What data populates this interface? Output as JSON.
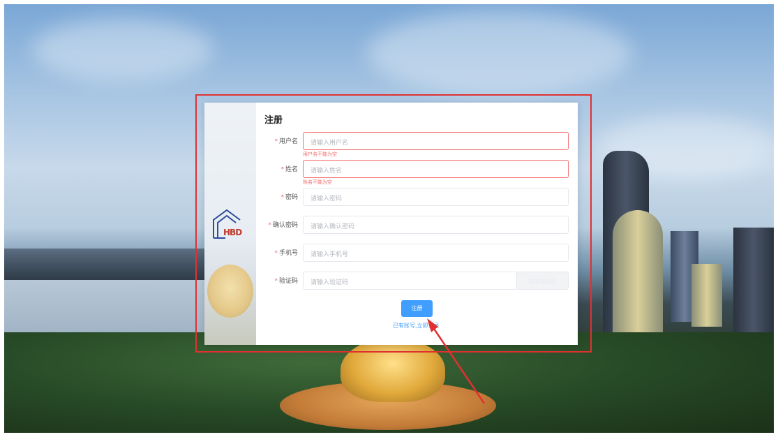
{
  "form": {
    "title": "注册",
    "fields": [
      {
        "label": "用户名",
        "required_mark": "*",
        "placeholder": "请输入用户名",
        "error": "用户名不能为空"
      },
      {
        "label": "姓名",
        "required_mark": "*",
        "placeholder": "请输入姓名",
        "error": "姓名不能为空"
      },
      {
        "label": "密码",
        "required_mark": "*",
        "placeholder": "请输入密码"
      },
      {
        "label": "确认密码",
        "required_mark": "*",
        "placeholder": "请输入确认密码"
      },
      {
        "label": "手机号",
        "required_mark": "*",
        "placeholder": "请输入手机号"
      },
      {
        "label": "验证码",
        "required_mark": "*",
        "placeholder": "请输入验证码"
      }
    ],
    "code_button": "获取验证码",
    "submit_label": "注册",
    "login_link": "已有账号,立即登录"
  },
  "brand": {
    "logo_text": "HBD",
    "logo_color": "#2f4b9a"
  },
  "colors": {
    "primary": "#409eff",
    "error": "#f56c6c",
    "annotation": "#e03131"
  },
  "icons": [
    "house-logo-icon",
    "annotation-arrow-icon"
  ]
}
